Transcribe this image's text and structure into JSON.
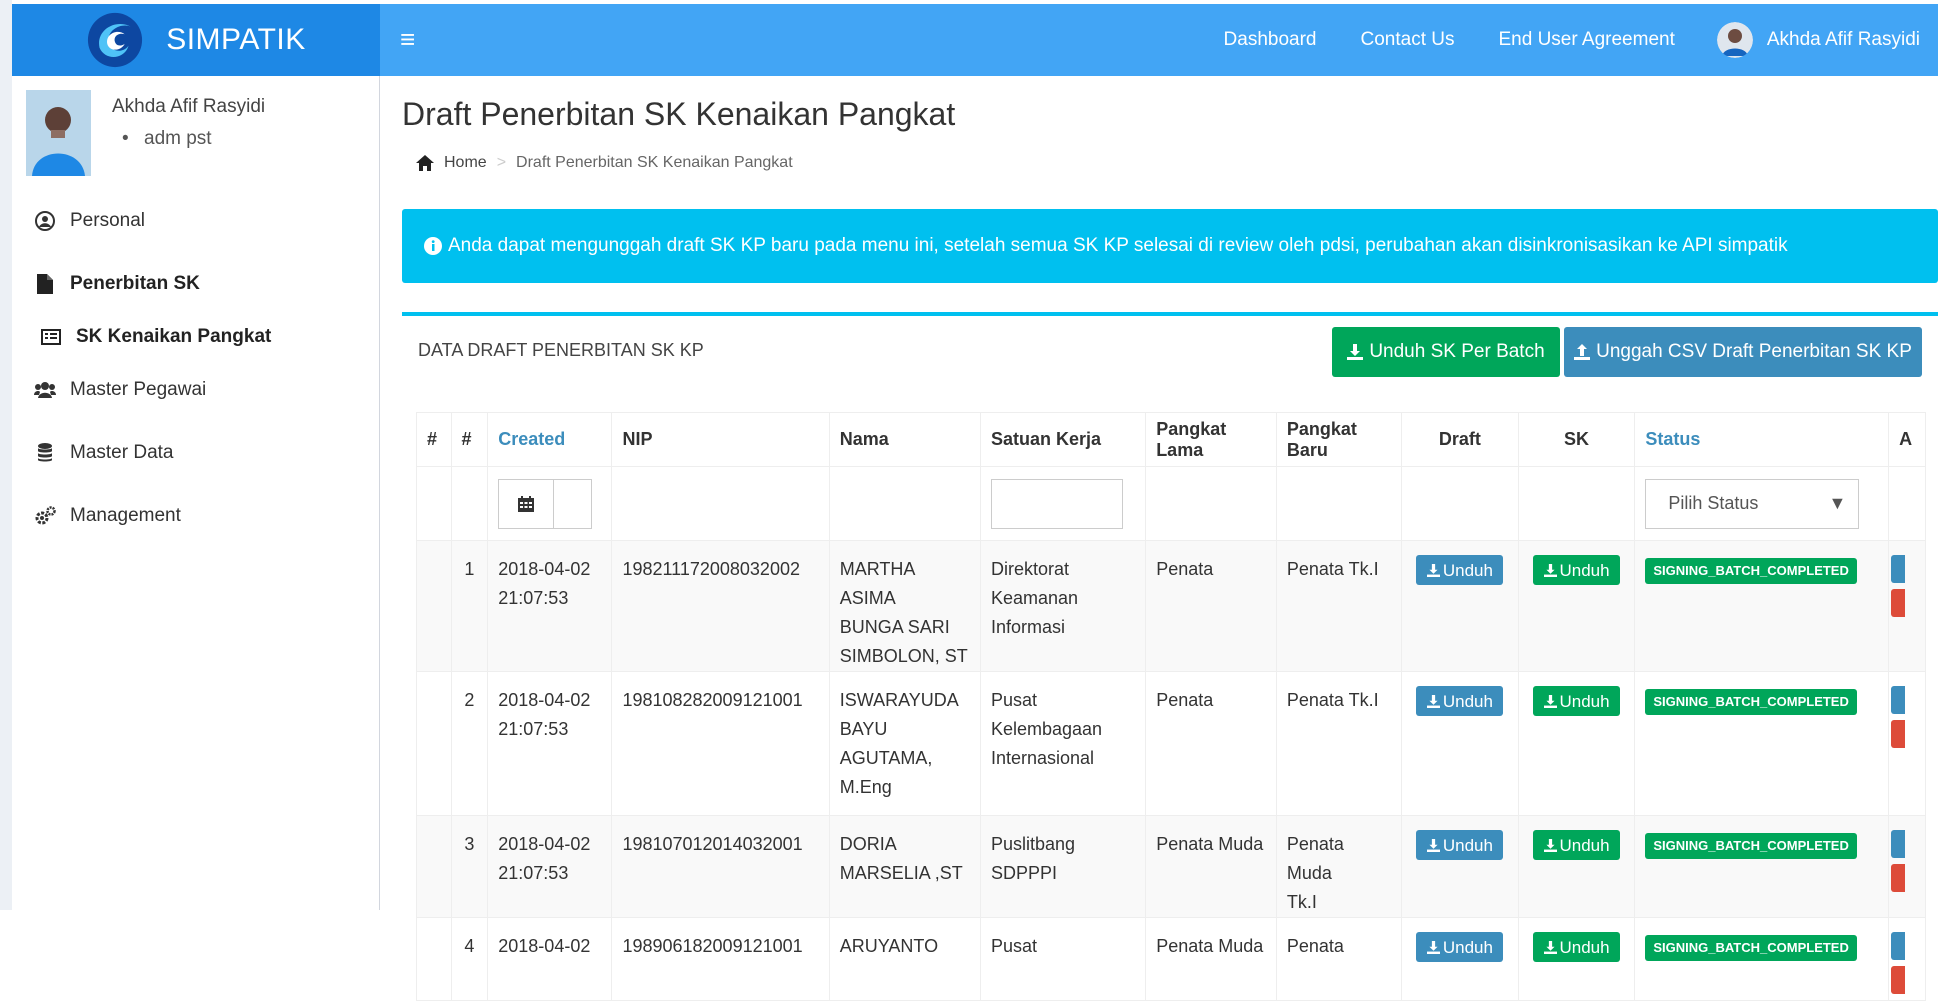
{
  "app": {
    "name": "SIMPATIK"
  },
  "topnav": {
    "dashboard": "Dashboard",
    "contact": "Contact Us",
    "agreement": "End User Agreement",
    "user_name": "Akhda Afif Rasyidi"
  },
  "sidebar": {
    "profile_name": "Akhda Afif Rasyidi",
    "profile_role": "adm pst",
    "items": [
      {
        "label": "Personal",
        "icon": "user-circle-icon"
      },
      {
        "label": "Penerbitan SK",
        "icon": "file-icon"
      },
      {
        "label": "SK Kenaikan Pangkat",
        "icon": "list-alt-icon"
      },
      {
        "label": "Master Pegawai",
        "icon": "users-icon"
      },
      {
        "label": "Master Data",
        "icon": "database-icon"
      },
      {
        "label": "Management",
        "icon": "cogs-icon"
      }
    ]
  },
  "page": {
    "title": "Draft Penerbitan SK Kenaikan Pangkat",
    "breadcrumb": {
      "home": "Home",
      "current": "Draft Penerbitan SK Kenaikan Pangkat"
    },
    "alert": "Anda dapat mengunggah draft SK KP baru pada menu ini, setelah semua SK KP selesai di review oleh pdsi, perubahan akan disinkronisasikan ke API simpatik"
  },
  "box": {
    "title": "DATA DRAFT PENERBITAN SK KP",
    "btn_batch": "Unduh SK Per Batch",
    "btn_csv": "Unggah CSV Draft Penerbitan SK KP"
  },
  "table": {
    "columns": [
      "#",
      "#",
      "Created",
      "NIP",
      "Nama",
      "Satuan Kerja",
      "Pangkat Lama",
      "Pangkat Baru",
      "Draft",
      "SK",
      "Status",
      "A"
    ],
    "status_filter": "Pilih Status",
    "unduh": "Unduh",
    "rows": [
      {
        "no": "1",
        "created_date": "2018-04-02",
        "created_time": "21:07:53",
        "nip": "198211172008032002",
        "nama": [
          "MARTHA ASIMA",
          "BUNGA SARI",
          "SIMBOLON, ST"
        ],
        "satker": [
          "Direktorat",
          "Keamanan",
          "Informasi"
        ],
        "pangkat_lama": "Penata",
        "pangkat_baru": [
          "Penata Tk.I"
        ],
        "status": "SIGNING_BATCH_COMPLETED"
      },
      {
        "no": "2",
        "created_date": "2018-04-02",
        "created_time": "21:07:53",
        "nip": "198108282009121001",
        "nama": [
          "ISWARAYUDA",
          "BAYU",
          "AGUTAMA,",
          "M.Eng"
        ],
        "satker": [
          "Pusat",
          "Kelembagaan",
          "Internasional"
        ],
        "pangkat_lama": "Penata",
        "pangkat_baru": [
          "Penata Tk.I"
        ],
        "status": "SIGNING_BATCH_COMPLETED"
      },
      {
        "no": "3",
        "created_date": "2018-04-02",
        "created_time": "21:07:53",
        "nip": "198107012014032001",
        "nama": [
          "DORIA",
          "MARSELIA ,ST"
        ],
        "satker": [
          "Puslitbang",
          "SDPPPI"
        ],
        "pangkat_lama": "Penata Muda",
        "pangkat_baru": [
          "Penata Muda",
          "Tk.I"
        ],
        "status": "SIGNING_BATCH_COMPLETED"
      },
      {
        "no": "4",
        "created_date": "2018-04-02",
        "created_time": "",
        "nip": "198906182009121001",
        "nama": [
          "ARUYANTO"
        ],
        "satker": [
          "Pusat"
        ],
        "pangkat_lama": "Penata Muda",
        "pangkat_baru": [
          "Penata"
        ],
        "status": "SIGNING_BATCH_COMPLETED"
      }
    ]
  },
  "colors": {
    "logo_bg": "#1e88e5",
    "topbar_bg": "#42a5f5",
    "alert_bg": "#00c0ef",
    "primary": "#3c8dbc",
    "success": "#00a65a",
    "danger": "#dd4b39"
  }
}
